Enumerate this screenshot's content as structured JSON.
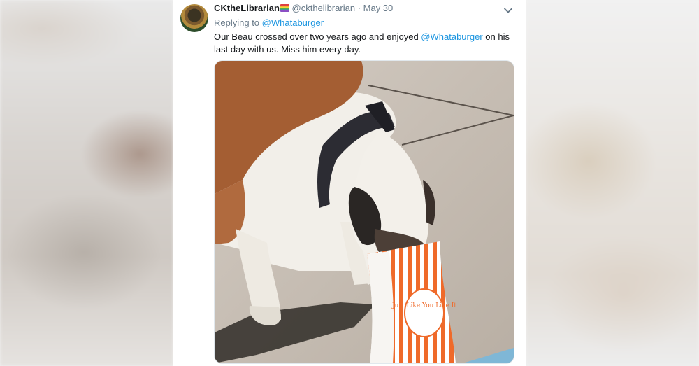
{
  "tweet": {
    "display_name": "CKtheLibrarian",
    "handle": "@ckthelibrarian",
    "separator": "·",
    "date": "May 30",
    "replying_prefix": "Replying to",
    "replying_to": "@Whataburger",
    "text_part1": "Our Beau crossed over two years ago and enjoyed ",
    "text_mention": "@Whataburger",
    "text_part2": " on his last day with us. Miss him every day.",
    "bag_text": "Just Like You Like It"
  },
  "colors": {
    "link": "#1b95e0",
    "secondary_text": "#657786",
    "primary_text": "#14171a"
  },
  "icons": {
    "menu": "chevron-down-icon",
    "flag": "rainbow-flag-icon"
  }
}
